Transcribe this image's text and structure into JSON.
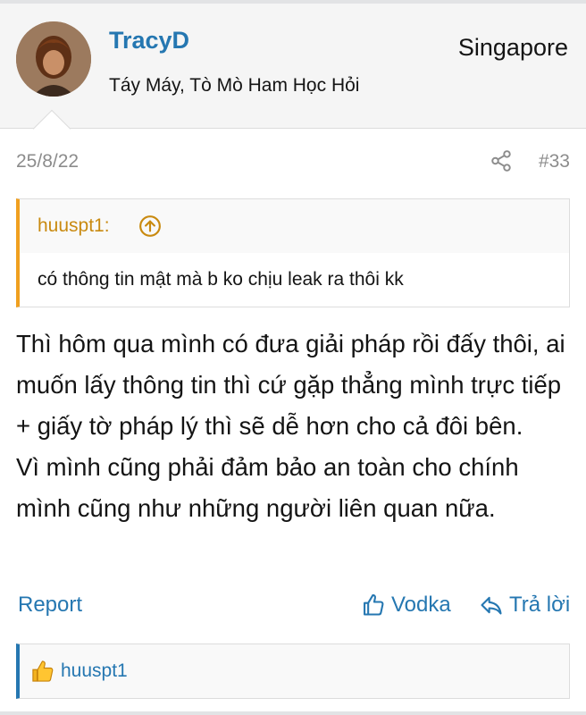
{
  "user": {
    "name": "TracyD",
    "title": "Táy Máy, Tò Mò Ham Học Hỏi",
    "location": "Singapore"
  },
  "post": {
    "date": "25/8/22",
    "number": "#33"
  },
  "quote": {
    "author": "huuspt1:",
    "text": "có thông tin mật mà b ko chịu leak ra thôi kk"
  },
  "message": {
    "paragraph1": "Thì hôm qua mình có đưa giải pháp rồi đấy thôi, ai muốn lấy thông tin thì cứ gặp thẳng mình trực tiếp + giấy tờ pháp lý thì sẽ dễ hơn cho cả đôi bên.",
    "paragraph2": "Vì mình cũng phải đảm bảo an toàn cho chính mình cũng như những người liên quan nữa."
  },
  "actions": {
    "report": "Report",
    "like": "Vodka",
    "reply": "Trả lời"
  },
  "reactions": {
    "users": "huuspt1"
  },
  "colors": {
    "link": "#2577b1",
    "quote_accent": "#f0a020",
    "meta": "#8c8c8c"
  }
}
